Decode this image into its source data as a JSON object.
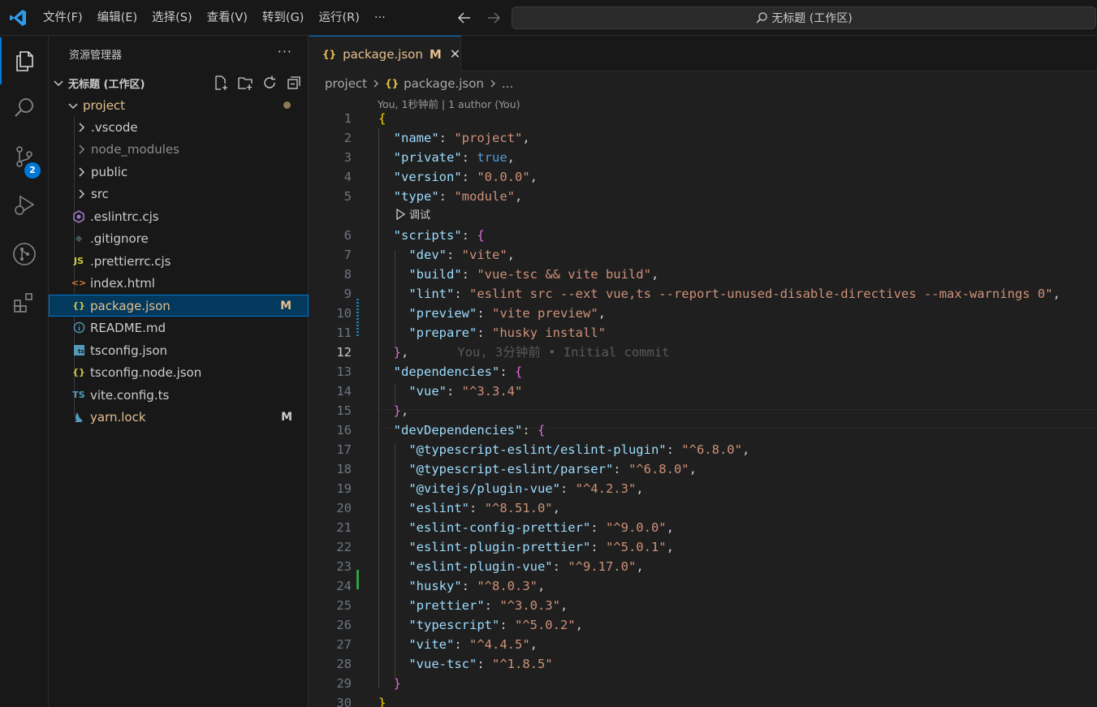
{
  "menu": [
    "文件(F)",
    "编辑(E)",
    "选择(S)",
    "查看(V)",
    "转到(G)",
    "运行(R)",
    "···"
  ],
  "command_center": {
    "label": "无标题 (工作区)"
  },
  "activity": {
    "source_control_badge": "2"
  },
  "sidebar": {
    "title": "资源管理器",
    "more": "···",
    "workspace": "无标题 (工作区)",
    "root_folder": "project",
    "items": [
      {
        "label": ".vscode",
        "type": "folder"
      },
      {
        "label": "node_modules",
        "type": "folder"
      },
      {
        "label": "public",
        "type": "folder"
      },
      {
        "label": "src",
        "type": "folder"
      },
      {
        "label": ".eslintrc.cjs",
        "type": "eslint"
      },
      {
        "label": ".gitignore",
        "type": "git"
      },
      {
        "label": ".prettierrc.cjs",
        "type": "js"
      },
      {
        "label": "index.html",
        "type": "html"
      },
      {
        "label": "package.json",
        "type": "json",
        "flag": "M"
      },
      {
        "label": "README.md",
        "type": "info"
      },
      {
        "label": "tsconfig.json",
        "type": "tsconfig"
      },
      {
        "label": "tsconfig.node.json",
        "type": "json"
      },
      {
        "label": "vite.config.ts",
        "type": "ts"
      },
      {
        "label": "yarn.lock",
        "type": "yarn",
        "flag": "M"
      }
    ]
  },
  "editor": {
    "tab": {
      "icon": "{}",
      "label": "package.json",
      "flag": "M",
      "close": "✕"
    },
    "breadcrumb": [
      "project",
      "package.json",
      "..."
    ],
    "codelens_top": "You, 1秒钟前 | 1 author (You)",
    "debug_lens": "调试",
    "blame_line12": "You, 3分钟前 • Initial commit",
    "lines": [
      "1",
      "2",
      "3",
      "4",
      "5",
      "6",
      "7",
      "8",
      "9",
      "10",
      "11",
      "12",
      "13",
      "14",
      "15",
      "16",
      "17",
      "18",
      "19",
      "20",
      "21",
      "22",
      "23",
      "24",
      "25",
      "26",
      "27",
      "28",
      "29",
      "30"
    ]
  },
  "colors": {
    "accent": "#0078d4",
    "modified": "#e2c08d",
    "string": "#ce9178",
    "key": "#9cdcfe",
    "boolean": "#569cd6"
  }
}
